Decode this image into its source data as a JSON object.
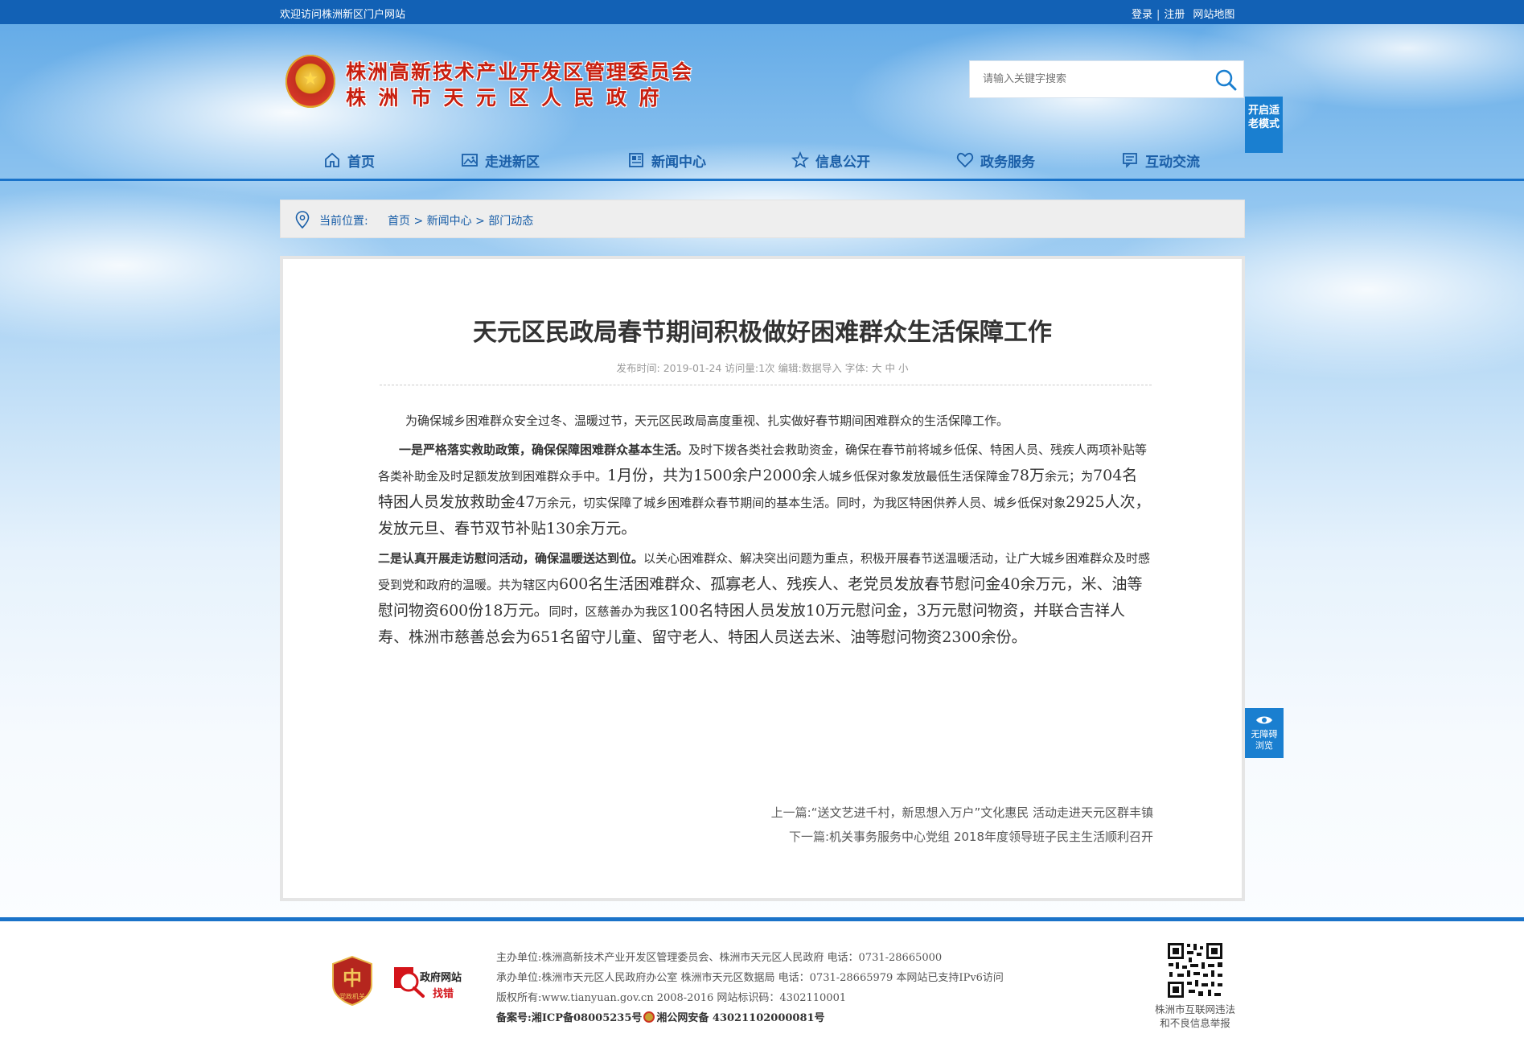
{
  "topbar": {
    "welcome": "欢迎访问株洲新区门户网站",
    "login": "登录",
    "divider": "|",
    "register": "注册",
    "sitemap": "网站地图"
  },
  "header": {
    "title_line1": "株洲高新技术产业开发区管理委员会",
    "title_line2": "株洲市天元区人民政府",
    "search_placeholder": "请输入关键字搜索",
    "elder_mode": "开启适老模式"
  },
  "nav": {
    "items": [
      {
        "label": "首页",
        "icon": "home-icon"
      },
      {
        "label": "走进新区",
        "icon": "picture-icon"
      },
      {
        "label": "新闻中心",
        "icon": "newspaper-icon"
      },
      {
        "label": "信息公开",
        "icon": "star-icon"
      },
      {
        "label": "政务服务",
        "icon": "heart-icon"
      },
      {
        "label": "互动交流",
        "icon": "chat-icon"
      }
    ]
  },
  "breadcrumb": {
    "label": "当前位置:",
    "items": [
      "首页",
      "新闻中心",
      "部门动态"
    ],
    "separator": ">"
  },
  "article": {
    "title": "天元区民政局春节期间积极做好困难群众生活保障工作",
    "meta": {
      "publish_label": "发布时间:",
      "publish_date": "2019-01-24",
      "views_label": "访问量:",
      "views": "1次",
      "editor_label": "编辑:",
      "editor": "数据导入",
      "font_label": "字体:",
      "font_large": "大",
      "font_medium": "中",
      "font_small": "小"
    },
    "p1": "为确保城乡困难群众安全过冬、温暖过节，天元区民政局高度重视、扎实做好春节期间困难群众的生活保障工作。",
    "p2_bold": "一是严格落实救助政策，确保保障困难群众基本生活。",
    "p2_a": "及时下拨各类社会救助资金，确保在春节前将城乡低保、特困人员、残疾人两项补贴等各类补助金及时足额发放到困难群众手中。",
    "p2_b": "1月份，共为1500余户2000余",
    "p2_c": "人城乡低保对象发放最低生活保障金",
    "p2_d": "78万",
    "p2_e": "余元；为",
    "p2_f": "704名特困人员发放救助金47",
    "p2_g": "万余元，切实保障了城乡困难群众春节期间的基本生活。同时，为我区特困供养人员、城乡低保对象",
    "p2_h": "2925人次，发放元旦、春节双节补贴130余万元。",
    "p3_bold": "二是认真开展走访慰问活动，确保温暖送达到位。",
    "p3_a": "以关心困难群众、解决突出问题为重点，积极开展春节送温暖活动，让广大城乡困难群众及时感受到党和政府的温暖。共为辖区内",
    "p3_b": "600名生活困难群众、孤寡老人、残疾人、老党员发放春节慰问金40余万元，米、油等慰问物资600份18万元。",
    "p3_c": "同时，区慈善办为我区",
    "p3_d": "100名特困人员发放10万元慰问金，3万元慰问物资，并联合吉祥人寿、株洲市慈善总会为651名留守儿童、留守老人、特困人员送去米、油等慰问物资2300余份。",
    "prev_label": "上一篇:",
    "prev_title": "“送文艺进千村，新思想入万户”文化惠民 活动走进天元区群丰镇",
    "next_label": "下一篇:",
    "next_title": "机关事务服务中心党组 2018年度领导班子民主生活顺利召开"
  },
  "accessibility": {
    "label1": "无障碍",
    "label2": "浏览"
  },
  "footer": {
    "badge1_text": "党政机关",
    "badge2_line1": "政府网站",
    "badge2_line2": "找错",
    "sponsor_label": "主办单位:",
    "sponsor": "株洲高新技术产业开发区管理委员会、株洲市天元区人民政府 电话：0731-28665000",
    "organizer_label": "承办单位:",
    "organizer": "株洲市天元区人民政府办公室 株洲市天元区数据局 电话：0731-28665979 本网站已支持IPv6访问",
    "copyright_label": "版权所有:",
    "copyright": "www.tianyuan.gov.cn 2008-2016 网站标识码：4302110001",
    "icp_label": "备案号:",
    "icp": "湘ICP备08005235号",
    "police": "湘公网安备 43021102000081号",
    "report_line1": "株洲市互联网违法",
    "report_line2": "和不良信息举报"
  }
}
